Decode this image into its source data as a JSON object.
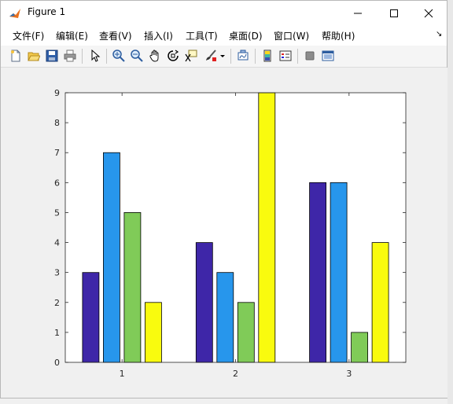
{
  "window": {
    "title": "Figure 1"
  },
  "menu": [
    {
      "label": "文件(F)"
    },
    {
      "label": "编辑(E)"
    },
    {
      "label": "查看(V)"
    },
    {
      "label": "插入(I)"
    },
    {
      "label": "工具(T)"
    },
    {
      "label": "桌面(D)"
    },
    {
      "label": "窗口(W)"
    },
    {
      "label": "帮助(H)"
    }
  ],
  "toolbar": {
    "icons": [
      "new-figure-icon",
      "open-file-icon",
      "save-icon",
      "print-icon",
      "pointer-icon",
      "zoom-in-icon",
      "zoom-out-icon",
      "pan-hand-icon",
      "rotate-3d-icon",
      "data-cursor-icon",
      "brush-icon",
      "link-plot-icon",
      "colorbar-icon",
      "legend-icon",
      "hide-plot-tools-icon",
      "show-plot-tools-icon"
    ]
  },
  "colors": {
    "series": [
      "#3e26a8",
      "#2796ec",
      "#80cb58",
      "#f9fb0e"
    ]
  },
  "chart_data": {
    "type": "bar",
    "categories": [
      "1",
      "2",
      "3"
    ],
    "series": [
      {
        "values": [
          3,
          4,
          6
        ]
      },
      {
        "values": [
          7,
          3,
          6
        ]
      },
      {
        "values": [
          5,
          2,
          1
        ]
      },
      {
        "values": [
          2,
          9,
          4
        ]
      }
    ],
    "yticks": [
      "0",
      "1",
      "2",
      "3",
      "4",
      "5",
      "6",
      "7",
      "8",
      "9"
    ],
    "ylim": [
      0,
      9
    ],
    "grid": false
  }
}
